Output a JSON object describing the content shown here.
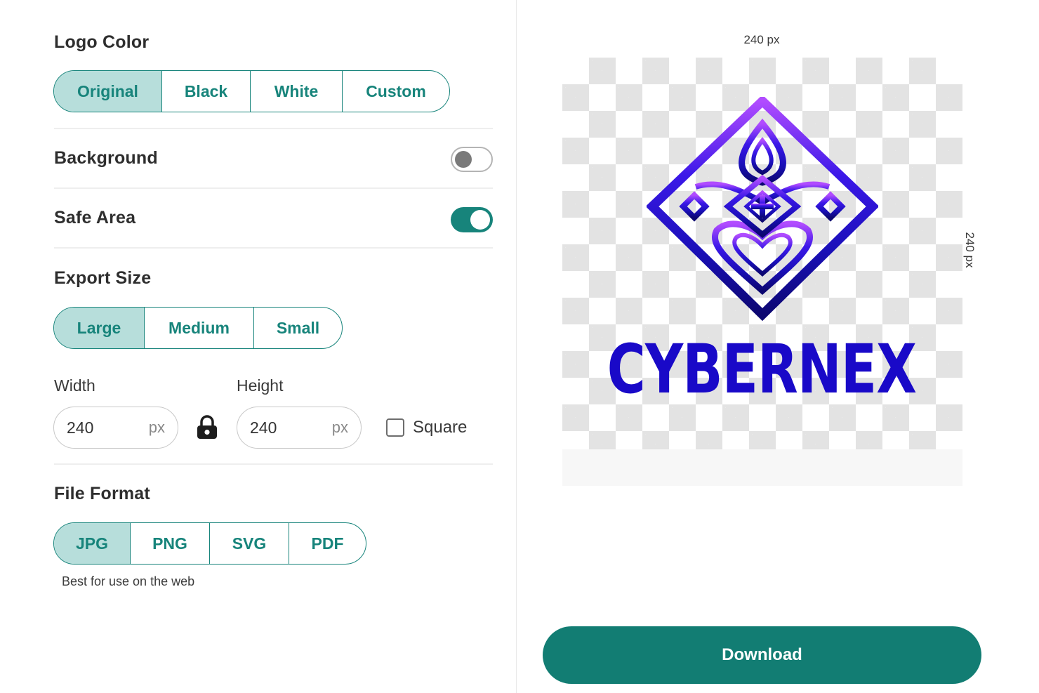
{
  "logo_color": {
    "title": "Logo Color",
    "options": [
      "Original",
      "Black",
      "White",
      "Custom"
    ],
    "selected": "Original"
  },
  "background": {
    "label": "Background",
    "enabled": false
  },
  "safe_area": {
    "label": "Safe Area",
    "enabled": true
  },
  "export_size": {
    "title": "Export Size",
    "options": [
      "Large",
      "Medium",
      "Small"
    ],
    "selected": "Large",
    "width_label": "Width",
    "height_label": "Height",
    "width_value": "240",
    "height_value": "240",
    "unit": "px",
    "lock_icon": "lock-icon",
    "square_label": "Square",
    "square_checked": false
  },
  "file_format": {
    "title": "File Format",
    "options": [
      "JPG",
      "PNG",
      "SVG",
      "PDF"
    ],
    "selected": "JPG",
    "hint": "Best for use on the web"
  },
  "preview": {
    "width_dim": "240 px",
    "height_dim": "240 px",
    "brand_name": "CYBERNEX",
    "logo_icon": "diamond-emblem-icon"
  },
  "download": {
    "label": "Download"
  },
  "colors": {
    "accent": "#17847b",
    "accent_light": "#b7dedb",
    "brand_blue": "#1909c8",
    "brand_purple": "#a64bff"
  }
}
